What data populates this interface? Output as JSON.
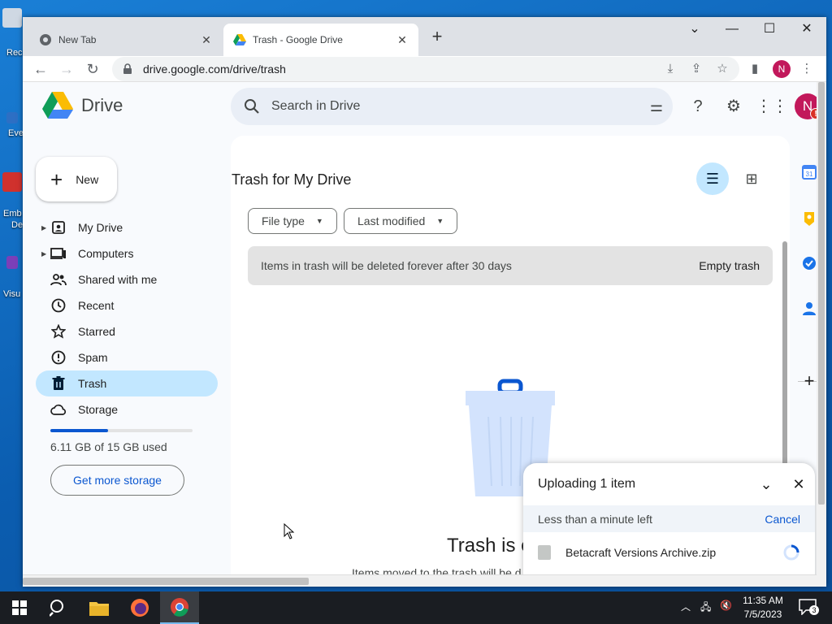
{
  "desktop": {
    "labels": [
      "Rec",
      "Eve",
      "Emb",
      "De",
      "Visu"
    ]
  },
  "browser": {
    "tabs": [
      {
        "title": "New Tab"
      },
      {
        "title": "Trash - Google Drive"
      }
    ],
    "url": "drive.google.com/drive/trash",
    "profile_initial": "N"
  },
  "drive": {
    "logo_text": "Drive",
    "search_placeholder": "Search in Drive",
    "avatar_initial": "N",
    "avatar_badge": "!",
    "new_label": "New",
    "nav": [
      {
        "label": "My Drive",
        "icon": "my-drive-icon",
        "caret": true
      },
      {
        "label": "Computers",
        "icon": "computers-icon",
        "caret": true
      },
      {
        "label": "Shared with me",
        "icon": "shared-icon"
      },
      {
        "label": "Recent",
        "icon": "clock-icon"
      },
      {
        "label": "Starred",
        "icon": "star-icon"
      },
      {
        "label": "Spam",
        "icon": "spam-icon"
      },
      {
        "label": "Trash",
        "icon": "trash-icon",
        "active": true
      },
      {
        "label": "Storage",
        "icon": "cloud-icon"
      }
    ],
    "storage": {
      "used_fraction": 0.407,
      "text": "6.11 GB of 15 GB used",
      "button": "Get more storage"
    },
    "main": {
      "title": "Trash for My Drive",
      "chips": [
        "File type",
        "Last modified"
      ],
      "banner_text": "Items in trash will be deleted forever after 30 days",
      "empty_trash": "Empty trash",
      "empty_title": "Trash is e",
      "empty_subtitle": "Items moved to the trash will be d"
    },
    "upload": {
      "title": "Uploading 1 item",
      "status": "Less than a minute left",
      "cancel": "Cancel",
      "file_name": "Betacraft Versions Archive.zip"
    }
  },
  "taskbar": {
    "time": "11:35 AM",
    "date": "7/5/2023",
    "notifications": "3"
  },
  "colors": {
    "accent": "#0b57d0",
    "active_nav": "#c2e7ff",
    "avatar": "#c2185b"
  }
}
